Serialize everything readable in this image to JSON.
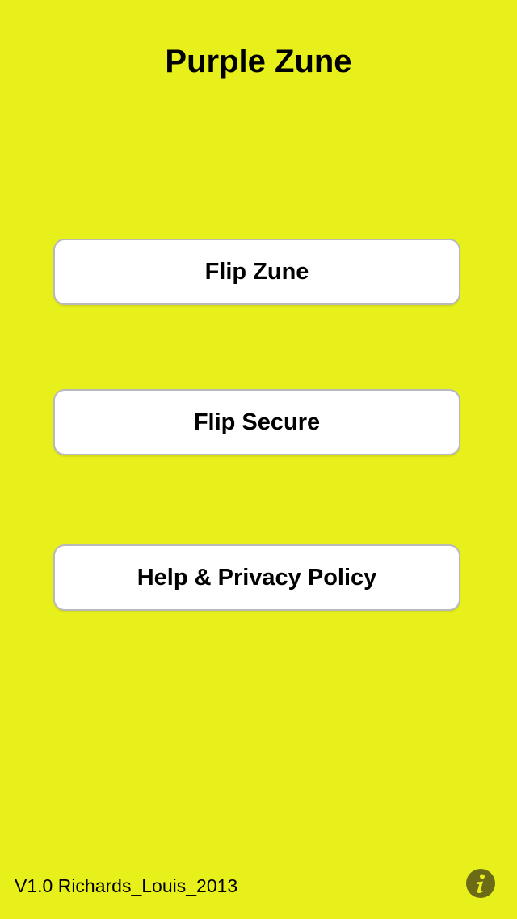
{
  "app": {
    "title": "Purple Zune"
  },
  "buttons": {
    "flip_zune": "Flip Zune",
    "flip_secure": "Flip Secure",
    "help_privacy": "Help & Privacy Policy"
  },
  "footer": {
    "version": "V1.0 Richards_Louis_2013",
    "info_icon": "info-icon"
  },
  "colors": {
    "background": "#e8f01c",
    "button_bg": "#ffffff",
    "button_border": "#b9b9b9",
    "info_icon": "#6b6a17"
  }
}
